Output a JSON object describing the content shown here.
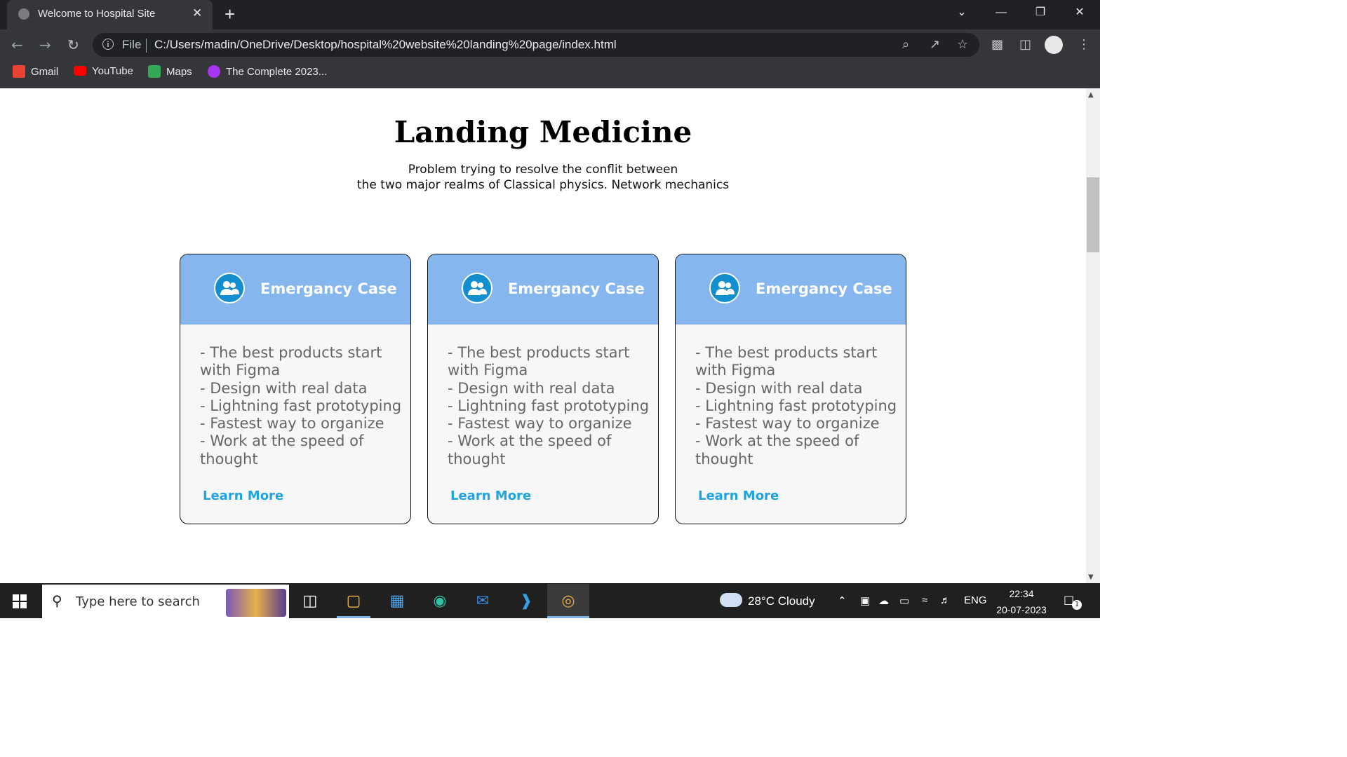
{
  "browser": {
    "tab_title": "Welcome to Hospital Site",
    "tab_close": "✕",
    "new_tab": "+",
    "window_controls": [
      "⌄",
      "—",
      "❐",
      "✕"
    ],
    "nav": {
      "back": "←",
      "forward": "→",
      "reload": "↻"
    },
    "address": {
      "scheme_label": "File",
      "url": "C:/Users/madin/OneDrive/Desktop/hospital%20website%20landing%20page/index.html"
    },
    "bookmarks": [
      {
        "label": "Gmail",
        "icon": "gmail-icon",
        "color": "#ea4335"
      },
      {
        "label": "YouTube",
        "icon": "youtube-icon",
        "color": "#ff0000"
      },
      {
        "label": "Maps",
        "icon": "maps-icon",
        "color": "#34a853"
      },
      {
        "label": "The Complete 2023...",
        "icon": "udemy-icon",
        "color": "#a435f0"
      }
    ]
  },
  "page": {
    "title": "Landing Medicine",
    "subtitle_line1": "Problem trying to resolve the conflit between",
    "subtitle_line2": "the two major realms of Classical physics. Network mechanics",
    "cards": [
      {
        "title": "Emergancy Case",
        "icon": "users-icon",
        "items": [
          "- The best products start with Figma",
          "- Design with real data",
          "- Lightning fast prototyping",
          "- Fastest way to organize",
          "- Work at the speed of thought"
        ],
        "link": "Learn More"
      },
      {
        "title": "Emergancy Case",
        "icon": "users-icon",
        "items": [
          "- The best products start with Figma",
          "- Design with real data",
          "- Lightning fast prototyping",
          "- Fastest way to organize",
          "- Work at the speed of thought"
        ],
        "link": "Learn More"
      },
      {
        "title": "Emergancy Case",
        "icon": "users-icon",
        "items": [
          "- The best products start with Figma",
          "- Design with real data",
          "- Lightning fast prototyping",
          "- Fastest way to organize",
          "- Work at the speed of thought"
        ],
        "link": "Learn More"
      }
    ],
    "colors": {
      "card_header": "#85b7ee",
      "icon_circle": "#138fcf",
      "link": "#1ea4df"
    }
  },
  "taskbar": {
    "search_placeholder": "Type here to search",
    "weather": "28°C  Cloudy",
    "language": "ENG",
    "time": "22:34",
    "date": "20-07-2023",
    "notification_count": "1"
  }
}
